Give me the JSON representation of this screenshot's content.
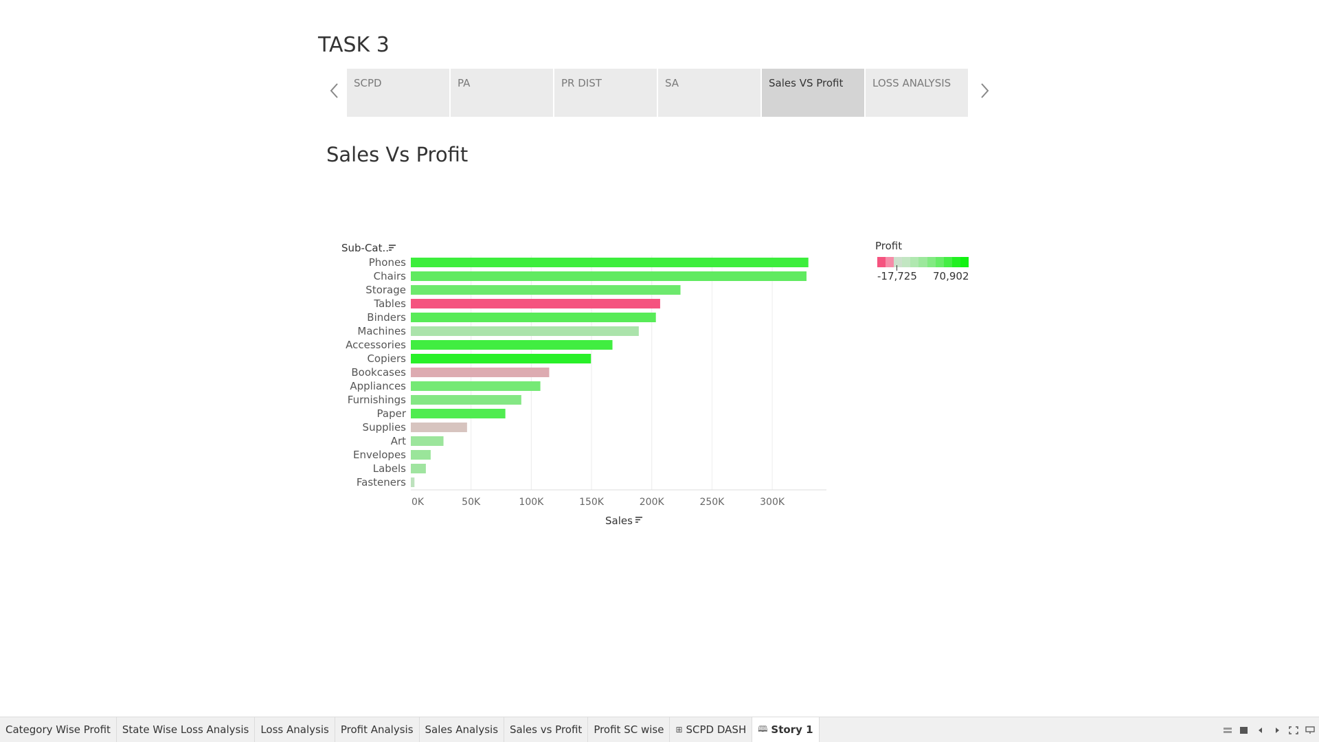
{
  "story": {
    "title": "TASK 3",
    "points": [
      "SCPD",
      "PA",
      "PR DIST",
      "SA",
      "Sales VS Profit",
      "LOSS ANALYSIS"
    ],
    "active_index": 4
  },
  "sheet": {
    "title": "Sales Vs Profit"
  },
  "chart_data": {
    "type": "bar",
    "orientation": "horizontal",
    "row_header": "Sub-Cat..",
    "xlabel": "Sales",
    "categories": [
      "Phones",
      "Chairs",
      "Storage",
      "Tables",
      "Binders",
      "Machines",
      "Accessories",
      "Copiers",
      "Bookcases",
      "Appliances",
      "Furnishings",
      "Paper",
      "Supplies",
      "Art",
      "Envelopes",
      "Labels",
      "Fasteners"
    ],
    "values": [
      330007,
      328449,
      223844,
      206966,
      203413,
      189239,
      167380,
      149528,
      114880,
      107532,
      91705,
      78479,
      46674,
      27119,
      16476,
      12486,
      3024
    ],
    "color_values": [
      44516,
      26590,
      21279,
      -17725,
      30222,
      3385,
      41937,
      55618,
      -3473,
      18138,
      13059,
      34054,
      -1189,
      6528,
      6964,
      5546,
      950
    ],
    "xlim": [
      0,
      345000
    ],
    "xticks": [
      0,
      50000,
      100000,
      150000,
      200000,
      250000,
      300000
    ],
    "xtick_labels": [
      "0K",
      "50K",
      "100K",
      "150K",
      "200K",
      "250K",
      "300K"
    ],
    "grid": true,
    "legend": {
      "title": "Profit",
      "min_label": "-17,725",
      "max_label": "70,902",
      "min": -17725,
      "max": 70902,
      "placement": "top-right",
      "ramp_colors": [
        "#f5537f",
        "#f58ca8",
        "#cce0cc",
        "#c2e6c2",
        "#b0e8b0",
        "#9ce89c",
        "#82ea82",
        "#66ec66",
        "#44ee44",
        "#22f022",
        "#11f211"
      ]
    }
  },
  "sheet_tabs": [
    "Category Wise Profit",
    "State Wise Loss Analysis",
    "Loss Analysis",
    "Profit Analysis",
    "Sales Analysis",
    "Sales vs Profit",
    "Profit SC wise",
    "SCPD DASH",
    "Story 1"
  ]
}
